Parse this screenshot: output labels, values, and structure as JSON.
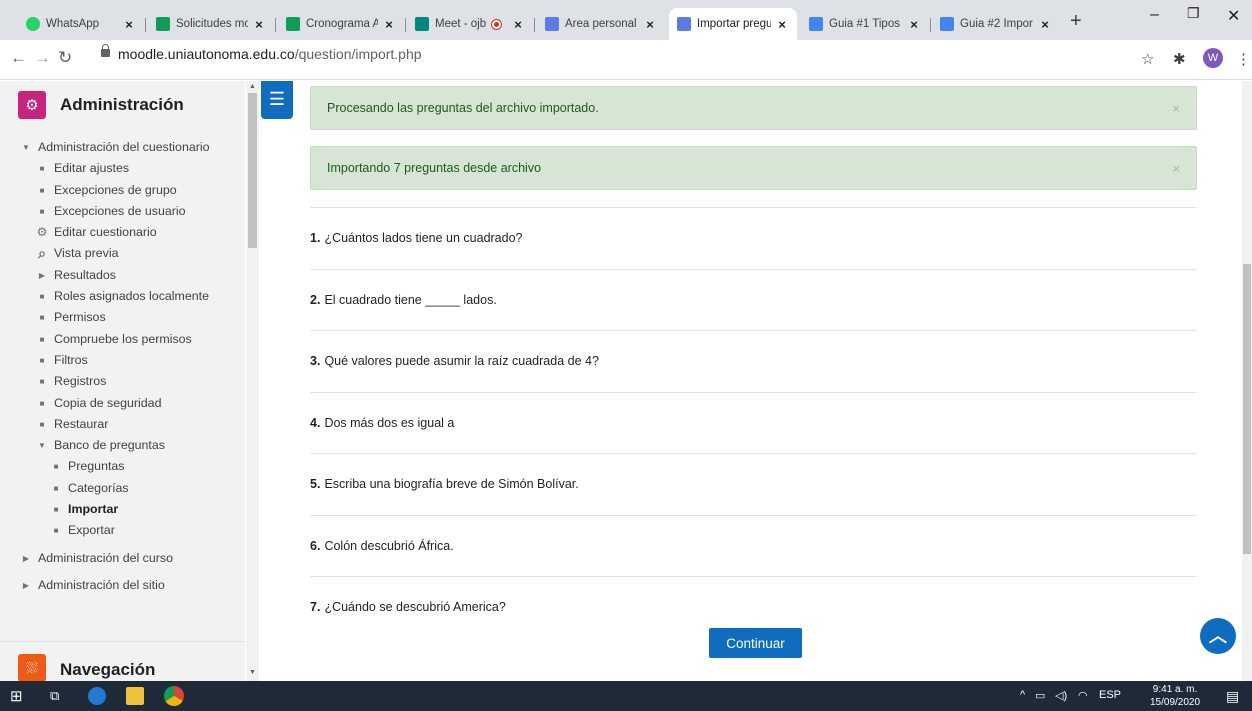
{
  "browser": {
    "tabs": [
      {
        "title": "WhatsApp",
        "icon": "whatsapp-icon",
        "color": "#25d366",
        "active": false
      },
      {
        "title": "Solicitudes mo",
        "icon": "sheet-icon",
        "color": "#0f9d58",
        "active": false
      },
      {
        "title": "Cronograma A",
        "icon": "sheet-icon",
        "color": "#0f9d58",
        "active": false
      },
      {
        "title": "Meet - ojb",
        "icon": "meet-icon",
        "color": "#00897b",
        "active": false,
        "recording": true
      },
      {
        "title": "Área personal",
        "icon": "moodle-icon",
        "color": "#5b7ce6",
        "active": false
      },
      {
        "title": "Importar pregu",
        "icon": "moodle-icon",
        "color": "#5b7ce6",
        "active": true
      },
      {
        "title": "Guia #1 Tipos",
        "icon": "doc-icon",
        "color": "#4285f4",
        "active": false
      },
      {
        "title": "Guia #2 Impor",
        "icon": "doc-icon",
        "color": "#4285f4",
        "active": false
      }
    ],
    "url_host": "moodle.uniautonoma.edu.co",
    "url_path": "/question/import.php",
    "profile_initial": "W"
  },
  "sidebar": {
    "title": "Administración",
    "items": [
      {
        "label": "Administración del cuestionario",
        "level": 1,
        "marker": "expanded"
      },
      {
        "label": "Editar ajustes",
        "level": 2,
        "marker": "bullet"
      },
      {
        "label": "Excepciones de grupo",
        "level": 2,
        "marker": "bullet"
      },
      {
        "label": "Excepciones de usuario",
        "level": 2,
        "marker": "bullet"
      },
      {
        "label": "Editar cuestionario",
        "level": 2,
        "marker": "gear"
      },
      {
        "label": "Vista previa",
        "level": 2,
        "marker": "search"
      },
      {
        "label": "Resultados",
        "level": 2,
        "marker": "collapsed"
      },
      {
        "label": "Roles asignados localmente",
        "level": 2,
        "marker": "bullet"
      },
      {
        "label": "Permisos",
        "level": 2,
        "marker": "bullet"
      },
      {
        "label": "Compruebe los permisos",
        "level": 2,
        "marker": "bullet"
      },
      {
        "label": "Filtros",
        "level": 2,
        "marker": "bullet"
      },
      {
        "label": "Registros",
        "level": 2,
        "marker": "bullet"
      },
      {
        "label": "Copia de seguridad",
        "level": 2,
        "marker": "bullet"
      },
      {
        "label": "Restaurar",
        "level": 2,
        "marker": "bullet"
      },
      {
        "label": "Banco de preguntas",
        "level": 2,
        "marker": "expanded"
      },
      {
        "label": "Preguntas",
        "level": 3,
        "marker": "bullet"
      },
      {
        "label": "Categorías",
        "level": 3,
        "marker": "bullet"
      },
      {
        "label": "Importar",
        "level": 3,
        "marker": "bullet",
        "bold": true
      },
      {
        "label": "Exportar",
        "level": 3,
        "marker": "bullet"
      },
      {
        "label": "Administración del curso",
        "level": 1,
        "marker": "collapsed",
        "gap": true
      },
      {
        "label": "Administración del sitio",
        "level": 1,
        "marker": "collapsed",
        "gap": true
      }
    ],
    "nav_title": "Navegación"
  },
  "main": {
    "alerts": [
      "Procesando las preguntas del archivo importado.",
      "Importando 7 preguntas desde archivo"
    ],
    "questions": [
      {
        "num": "1.",
        "text": "¿Cuántos lados tiene un cuadrado?"
      },
      {
        "num": "2.",
        "text": "El cuadrado tiene _____ lados."
      },
      {
        "num": "3.",
        "text": "Qué valores puede asumir la raíz cuadrada de 4?"
      },
      {
        "num": "4.",
        "text": "Dos más dos es igual a"
      },
      {
        "num": "5.",
        "text": "Escriba una biografía breve de Simón Bolívar."
      },
      {
        "num": "6.",
        "text": "Colón descubrió África."
      },
      {
        "num": "7.",
        "text": "¿Cuándo se descubrió America?"
      }
    ],
    "continue_label": "Continuar"
  },
  "taskbar": {
    "time": "9:41 a. m.",
    "date": "15/09/2020",
    "lang": "ESP"
  },
  "colors": {
    "accent": "#0f6cbf",
    "admin_icon": "#c8247e",
    "nav_icon": "#ef5a14",
    "alert_bg": "#d7e6d4"
  }
}
